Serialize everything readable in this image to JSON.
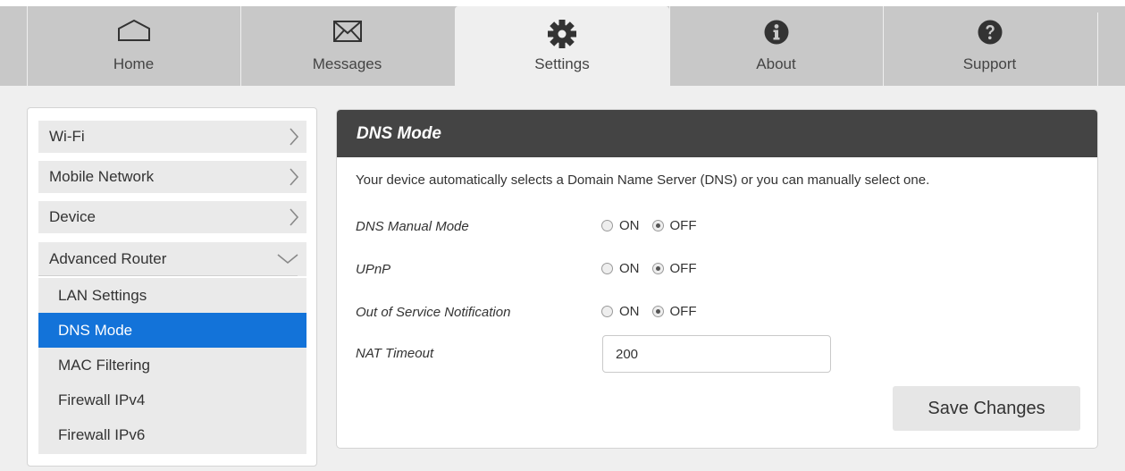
{
  "nav": {
    "tabs": [
      {
        "label": "Home",
        "icon": "home-icon"
      },
      {
        "label": "Messages",
        "icon": "envelope-icon"
      },
      {
        "label": "Settings",
        "icon": "gear-icon"
      },
      {
        "label": "About",
        "icon": "info-icon"
      },
      {
        "label": "Support",
        "icon": "question-icon"
      }
    ],
    "active": "Settings"
  },
  "sidebar": {
    "items": [
      {
        "label": "Wi-Fi"
      },
      {
        "label": "Mobile Network"
      },
      {
        "label": "Device"
      },
      {
        "label": "Advanced Router"
      }
    ],
    "sub_items": [
      {
        "label": "LAN Settings"
      },
      {
        "label": "DNS Mode"
      },
      {
        "label": "MAC Filtering"
      },
      {
        "label": "Firewall IPv4"
      },
      {
        "label": "Firewall IPv6"
      }
    ],
    "active_sub": "DNS Mode"
  },
  "panel": {
    "title": "DNS Mode",
    "description": "Your device automatically selects a Domain Name Server (DNS) or you can manually select one.",
    "rows": [
      {
        "label": "DNS Manual Mode",
        "on_label": "ON",
        "off_label": "OFF",
        "value": "OFF"
      },
      {
        "label": "UPnP",
        "on_label": "ON",
        "off_label": "OFF",
        "value": "OFF"
      },
      {
        "label": "Out of Service Notification",
        "on_label": "ON",
        "off_label": "OFF",
        "value": "OFF"
      }
    ],
    "nat": {
      "label": "NAT Timeout",
      "value": "200"
    },
    "save_label": "Save Changes"
  },
  "colors": {
    "accent": "#1373d9",
    "header": "#444444",
    "nav_bg": "#c8c8c8"
  }
}
